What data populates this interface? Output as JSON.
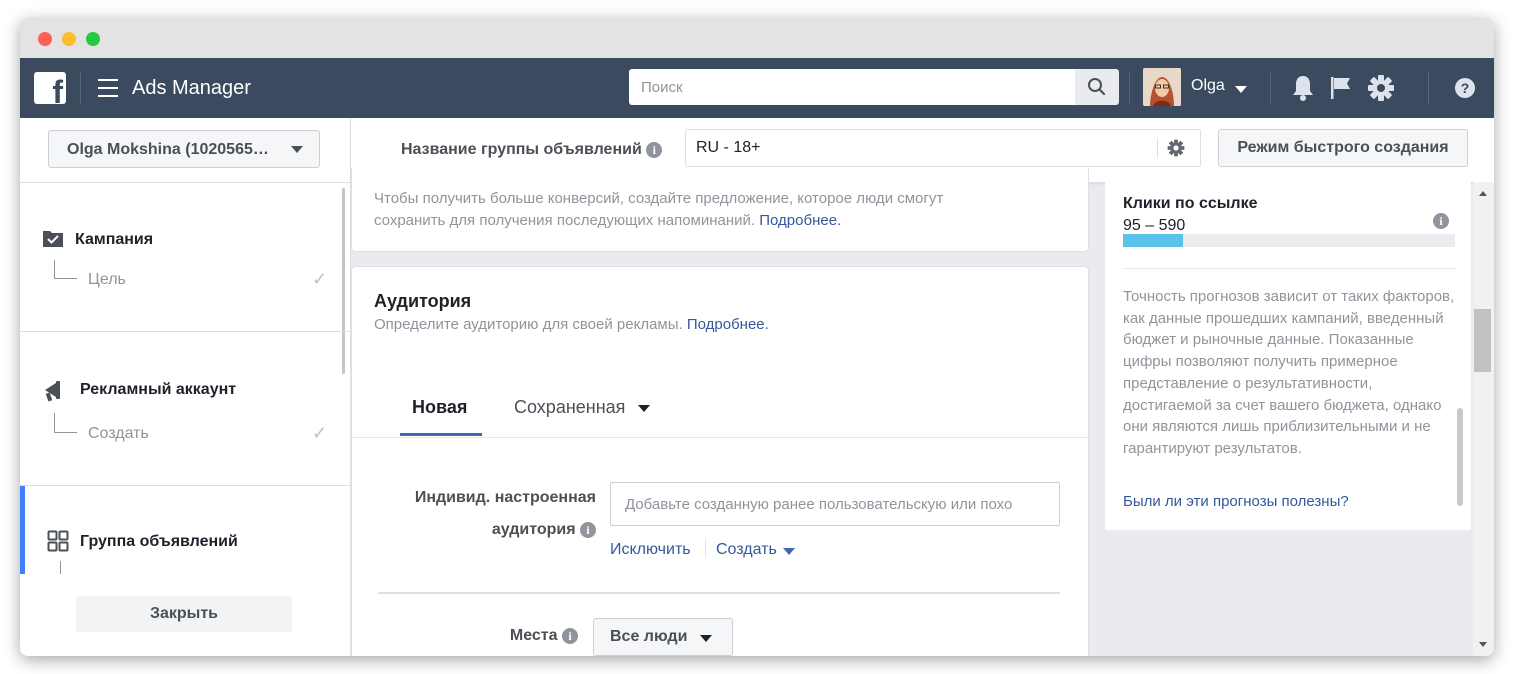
{
  "app": {
    "title": "Ads Manager",
    "search_placeholder": "Поиск",
    "user_name": "Olga"
  },
  "sidebar": {
    "account_selector": "Olga Mokshina (1020565…",
    "steps": [
      {
        "title": "Кампания",
        "sub": "Цель",
        "done": true
      },
      {
        "title": "Рекламный аккаунт",
        "sub": "Создать",
        "done": true
      },
      {
        "title": "Группа объявлений",
        "active": true
      }
    ],
    "close_label": "Закрыть"
  },
  "adset": {
    "name_label": "Название группы объявлений",
    "name_value": "RU - 18+",
    "quick_mode_label": "Режим быстрого создания"
  },
  "offer_card": {
    "text": "Чтобы получить больше конверсий, создайте предложение, которое люди смогут сохранить для получения последующих напоминаний.",
    "link": "Подробнее."
  },
  "audience": {
    "title": "Аудитория",
    "subtitle": "Определите аудиторию для своей рекламы.",
    "subtitle_link": "Подробнее.",
    "tabs": [
      {
        "label": "Новая",
        "active": true
      },
      {
        "label": "Сохраненная",
        "active": false
      }
    ],
    "custom_label_line1": "Индивид. настроенная",
    "custom_label_line2": "аудитория",
    "custom_placeholder": "Добавьте созданную ранее пользовательскую или похо",
    "exclude_link": "Исключить",
    "create_link": "Создать",
    "locations_label": "Места",
    "locations_value": "Все люди"
  },
  "estimate": {
    "title": "Клики по ссылке",
    "range": "95 – 590",
    "bar_fraction": 0.18,
    "disclaimer": "Точность прогнозов зависит от таких факторов, как данные прошедших кампаний, введенный бюджет и рыночные данные. Показанные цифры позволяют получить примерное представление о результативности, достигаемой за счет вашего бюджета, однако они являются лишь приблизительными и не гарантируют результатов.",
    "feedback_link": "Были ли эти прогнозы полезны?"
  },
  "colors": {
    "topbar": "#3b4a5e",
    "link": "#365899",
    "accent": "#4267b2",
    "estimate_bar": "#5bc2ec"
  }
}
